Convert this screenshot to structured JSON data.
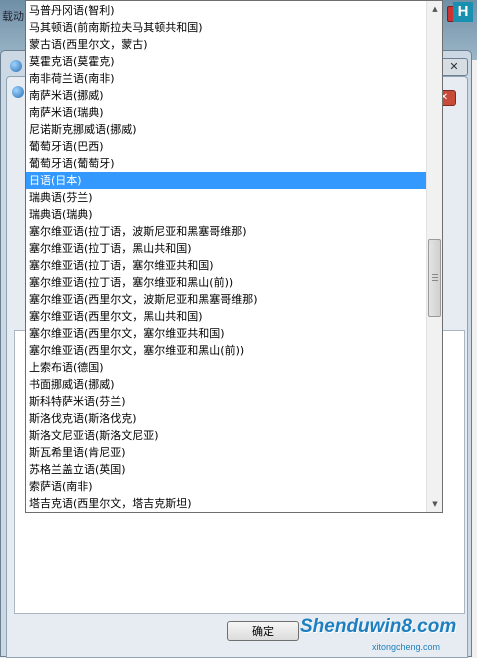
{
  "background": {
    "top_text": "载动",
    "ok_label": "确定"
  },
  "dropdown": {
    "items": [
      "马普丹冈语(智利)",
      "马其顿语(前南斯拉夫马其顿共和国)",
      "蒙古语(西里尔文，蒙古)",
      "莫霍克语(莫霍克)",
      "南非荷兰语(南非)",
      "南萨米语(挪威)",
      "南萨米语(瑞典)",
      "尼诺斯克挪威语(挪威)",
      "葡萄牙语(巴西)",
      "葡萄牙语(葡萄牙)",
      "日语(日本)",
      "瑞典语(芬兰)",
      "瑞典语(瑞典)",
      "塞尔维亚语(拉丁语，波斯尼亚和黑塞哥维那)",
      "塞尔维亚语(拉丁语，黑山共和国)",
      "塞尔维亚语(拉丁语，塞尔维亚共和国)",
      "塞尔维亚语(拉丁语，塞尔维亚和黑山(前))",
      "塞尔维亚语(西里尔文，波斯尼亚和黑塞哥维那)",
      "塞尔维亚语(西里尔文，黑山共和国)",
      "塞尔维亚语(西里尔文，塞尔维亚共和国)",
      "塞尔维亚语(西里尔文，塞尔维亚和黑山(前))",
      "上索布语(德国)",
      "书面挪威语(挪威)",
      "斯科特萨米语(芬兰)",
      "斯洛伐克语(斯洛伐克)",
      "斯洛文尼亚语(斯洛文尼亚)",
      "斯瓦希里语(肯尼亚)",
      "苏格兰盖立语(英国)",
      "索萨语(南非)",
      "塔吉克语(西里尔文，塔吉克斯坦)"
    ],
    "selected_index": 10,
    "scroll_up": "▲",
    "scroll_down": "▼"
  },
  "watermark": {
    "text": "Shenduwin8.com",
    "sub": "xitongcheng.com"
  },
  "colors": {
    "selection": "#3399ff",
    "watermark": "#1e7fc0"
  }
}
